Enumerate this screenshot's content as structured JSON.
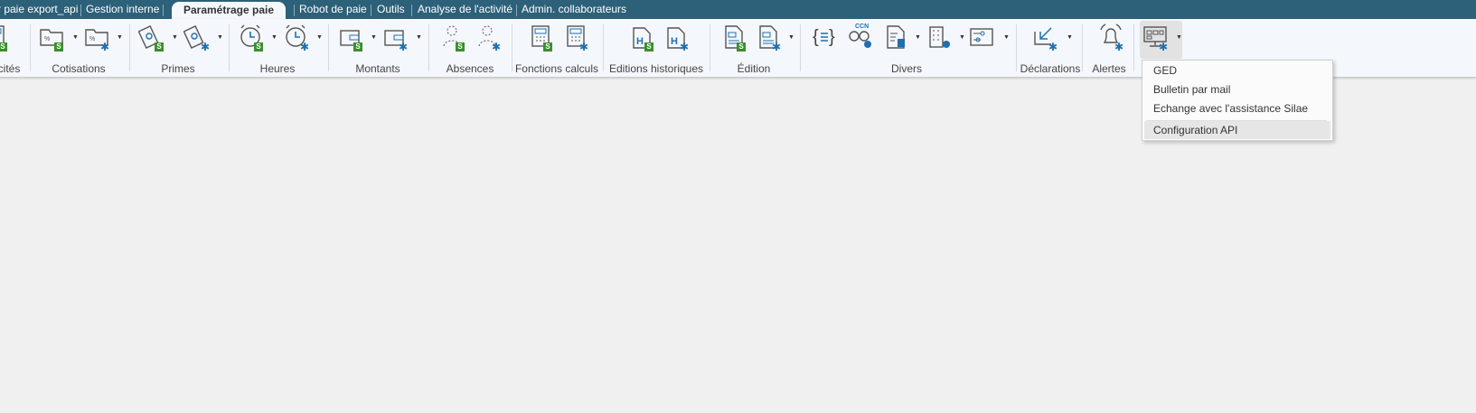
{
  "tabs": [
    {
      "label": "r paie export_api"
    },
    {
      "label": "Gestion interne"
    },
    {
      "label": "Paramétrage paie",
      "active": true
    },
    {
      "label": "Robot de paie"
    },
    {
      "label": "Outils"
    },
    {
      "label": "Analyse de l'activité"
    },
    {
      "label": "Admin. collaborateurs"
    }
  ],
  "groups": [
    {
      "label": "cités"
    },
    {
      "label": "Cotisations"
    },
    {
      "label": "Primes"
    },
    {
      "label": "Heures"
    },
    {
      "label": "Montants"
    },
    {
      "label": "Absences"
    },
    {
      "label": "Fonctions calculs"
    },
    {
      "label": "Editions historiques"
    },
    {
      "label": "Édition"
    },
    {
      "label": "Divers"
    },
    {
      "label": "Déclarations"
    },
    {
      "label": "Alertes"
    }
  ],
  "icons": {
    "badge_s": "S",
    "gear": "✱",
    "ccn": "CCN",
    "history": "H"
  },
  "menu": {
    "items": [
      {
        "label": "GED"
      },
      {
        "label": "Bulletin par mail"
      },
      {
        "label": "Echange avec l'assistance Silae"
      },
      {
        "label": "Configuration API",
        "highlighted": true
      }
    ]
  },
  "colors": {
    "tabbar": "#2d6079",
    "badge": "#3a8f2c",
    "gear": "#1f6fb0"
  }
}
